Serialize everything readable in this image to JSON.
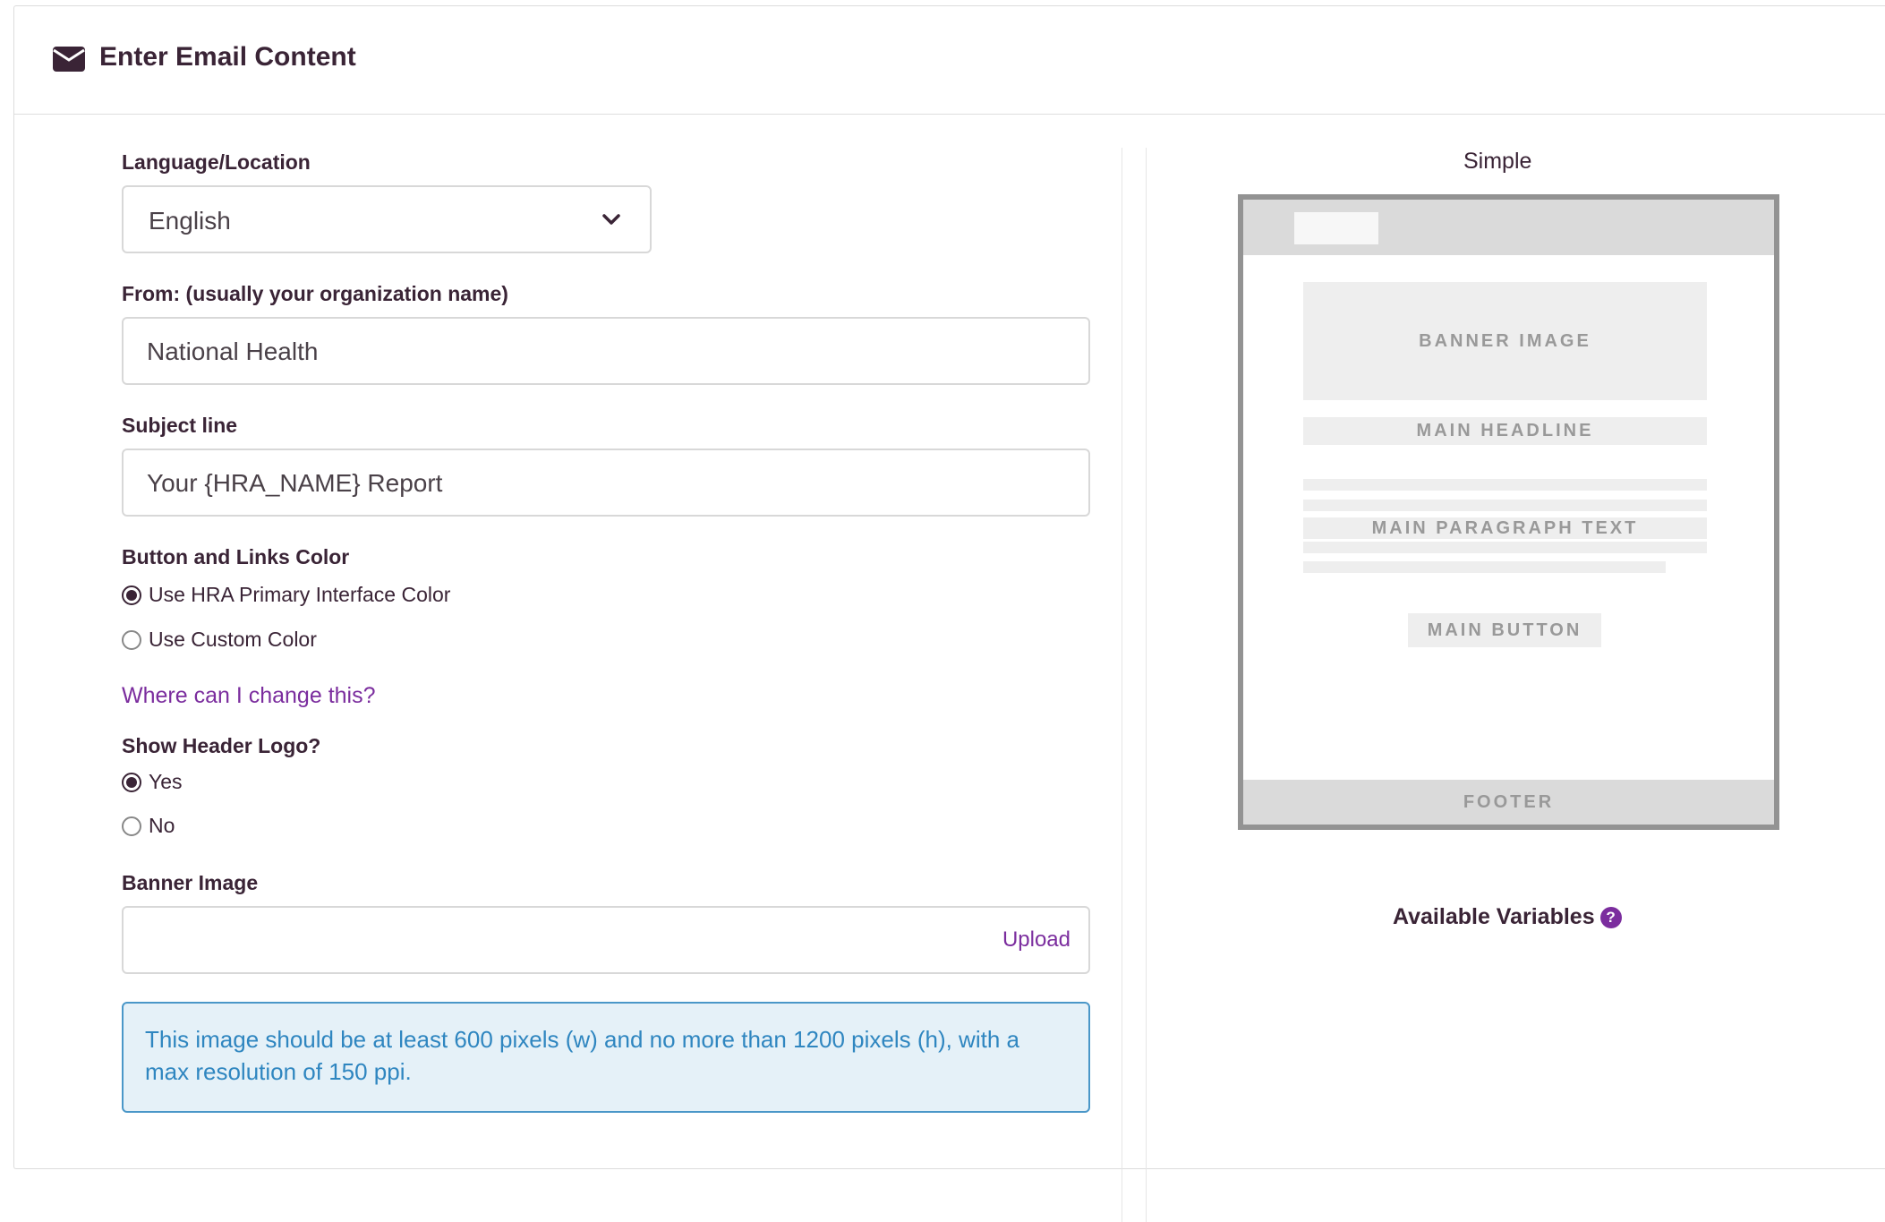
{
  "header": {
    "title": "Enter Email Content",
    "icon": "envelope-icon"
  },
  "form": {
    "language": {
      "label": "Language/Location",
      "value": "English"
    },
    "from": {
      "label": "From: (usually your organization name)",
      "value": "National Health"
    },
    "subject": {
      "label": "Subject line",
      "value": "Your {HRA_NAME} Report"
    },
    "button_color": {
      "label": "Button and Links Color",
      "options": [
        {
          "label": "Use HRA Primary Interface Color",
          "selected": true
        },
        {
          "label": "Use Custom Color",
          "selected": false
        }
      ]
    },
    "change_link": "Where can I change this?",
    "header_logo": {
      "label": "Show Header Logo?",
      "options": [
        {
          "label": "Yes",
          "selected": true
        },
        {
          "label": "No",
          "selected": false
        }
      ]
    },
    "banner_image": {
      "label": "Banner Image",
      "value": "",
      "upload_label": "Upload"
    },
    "info": "This image should be at least 600 pixels (w) and no more than 1200 pixels (h), with a max resolution of 150 ppi."
  },
  "preview": {
    "template_name": "Simple",
    "banner": "BANNER IMAGE",
    "headline": "MAIN HEADLINE",
    "paragraph": "MAIN PARAGRAPH TEXT",
    "button": "MAIN BUTTON",
    "footer": "FOOTER",
    "available_variables": "Available Variables"
  },
  "colors": {
    "accent": "#7b2d9e",
    "text": "#3a2436",
    "info_bg": "#e5f1f8",
    "info_text": "#2f86c0"
  }
}
